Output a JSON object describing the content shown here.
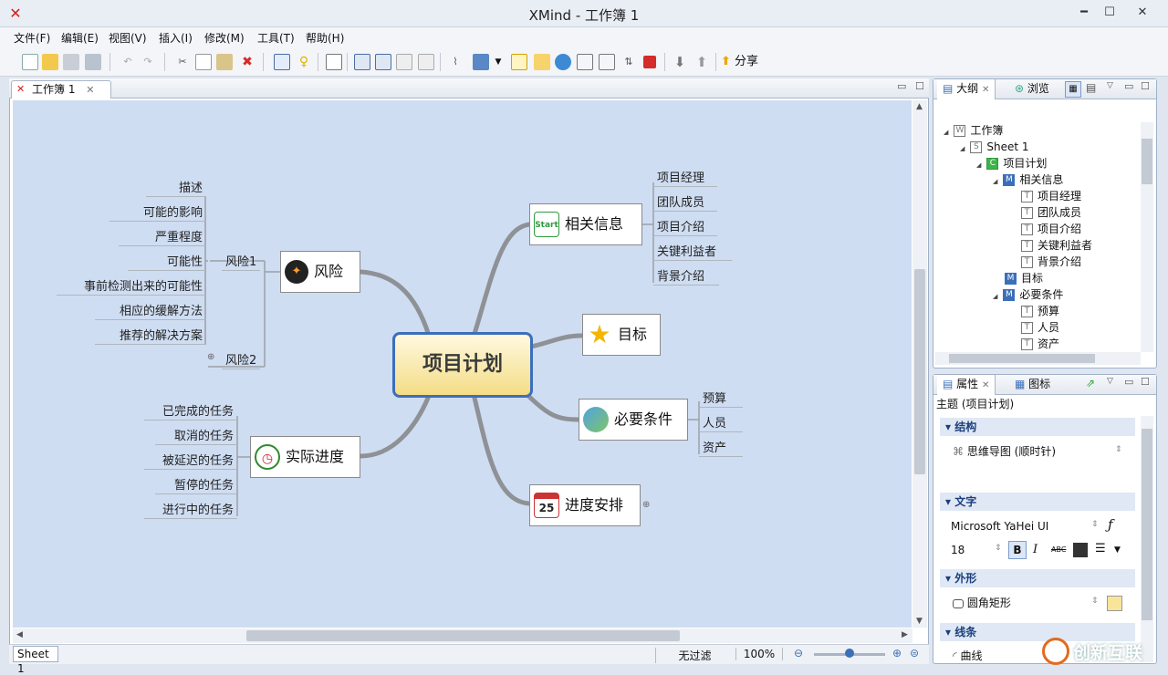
{
  "window": {
    "title": "XMind - 工作簿 1",
    "minimize": "━",
    "restore": "☐",
    "close": "✕"
  },
  "menu": [
    "文件(F)",
    "编辑(E)",
    "视图(V)",
    "插入(I)",
    "修改(M)",
    "工具(T)",
    "帮助(H)"
  ],
  "toolbar": {
    "share_label": "分享",
    "share_icon": "share-arrow-icon"
  },
  "editor": {
    "tab_label": "工作簿 1",
    "sheet_tab": "Sheet 1",
    "filter": "无过滤",
    "zoom": "100%"
  },
  "mindmap": {
    "central": "项目计划",
    "risk": {
      "label": "风险",
      "group1": "风险1",
      "group2": "风险2",
      "items": [
        "描述",
        "可能的影响",
        "严重程度",
        "可能性",
        "事前检测出来的可能性",
        "相应的缓解方法",
        "推荐的解决方案"
      ]
    },
    "info": {
      "label": "相关信息",
      "icon_text": "Start",
      "items": [
        "项目经理",
        "团队成员",
        "项目介绍",
        "关键利益者",
        "背景介绍"
      ]
    },
    "goal": {
      "label": "目标"
    },
    "requirements": {
      "label": "必要条件",
      "items": [
        "预算",
        "人员",
        "资产"
      ]
    },
    "progress": {
      "label": "实际进度",
      "items": [
        "已完成的任务",
        "取消的任务",
        "被延迟的任务",
        "暂停的任务",
        "进行中的任务"
      ]
    },
    "schedule": {
      "label": "进度安排",
      "icon_text": "25"
    }
  },
  "outline": {
    "tab": "大纲",
    "tab2": "浏览",
    "rows": [
      {
        "label": "工作簿",
        "icon": "W",
        "level": 0
      },
      {
        "label": "Sheet 1",
        "icon": "S",
        "level": 1
      },
      {
        "label": "项目计划",
        "icon": "C",
        "level": 2
      },
      {
        "label": "相关信息",
        "icon": "M",
        "level": 3
      },
      {
        "label": "项目经理",
        "icon": "T",
        "level": 4
      },
      {
        "label": "团队成员",
        "icon": "T",
        "level": 4
      },
      {
        "label": "项目介绍",
        "icon": "T",
        "level": 4
      },
      {
        "label": "关键利益者",
        "icon": "T",
        "level": 4
      },
      {
        "label": "背景介绍",
        "icon": "T",
        "level": 4
      },
      {
        "label": "目标",
        "icon": "M",
        "level": 3
      },
      {
        "label": "必要条件",
        "icon": "M",
        "level": 3
      },
      {
        "label": "预算",
        "icon": "T",
        "level": 4
      },
      {
        "label": "人员",
        "icon": "T",
        "level": 4
      },
      {
        "label": "资产",
        "icon": "T",
        "level": 4
      }
    ]
  },
  "properties": {
    "tab": "属性",
    "tab2": "图标",
    "subject": "主题 (项目计划)",
    "structure_head": "结构",
    "structure_value": "思维导图 (顺时针)",
    "text_head": "文字",
    "font": "Microsoft YaHei UI",
    "size": "18",
    "shape_head": "外形",
    "shape_value": "圆角矩形",
    "line_head": "线条",
    "line_value": "曲线"
  },
  "watermark": "创新互联"
}
